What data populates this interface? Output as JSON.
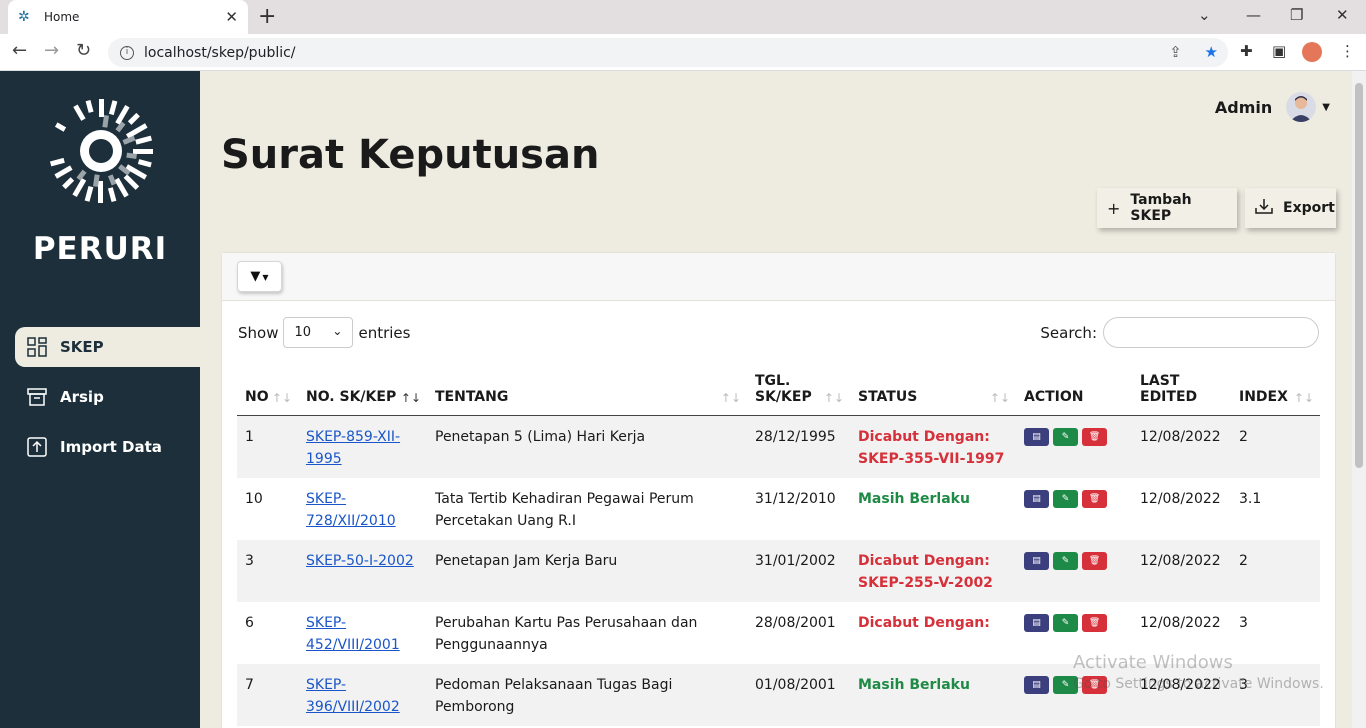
{
  "browser": {
    "tab_title": "Home",
    "url": "localhost/skep/public/"
  },
  "sidebar": {
    "brand": "PERURI",
    "items": [
      {
        "label": "SKEP",
        "icon": "grid-icon"
      },
      {
        "label": "Arsip",
        "icon": "archive-icon"
      },
      {
        "label": "Import Data",
        "icon": "upload-icon"
      }
    ]
  },
  "header": {
    "user": "Admin",
    "title": "Surat Keputusan",
    "add_button": "Tambah SKEP",
    "export_button": "Export"
  },
  "table_controls": {
    "show_label": "Show",
    "entries_value": "10",
    "entries_label": "entries",
    "search_label": "Search:"
  },
  "table": {
    "columns": [
      "NO",
      "NO. SK/KEP",
      "TENTANG",
      "TGL. SK/KEP",
      "STATUS",
      "ACTION",
      "LAST EDITED",
      "INDEX"
    ],
    "rows": [
      {
        "no": "1",
        "sk": "SKEP-859-XII-1995",
        "tentang": "Penetapan 5 (Lima) Hari Kerja",
        "tgl": "28/12/1995",
        "status": "Dicabut Dengan: SKEP-355-VII-1997",
        "status_type": "revoked",
        "edited": "12/08/2022",
        "index": "2"
      },
      {
        "no": "10",
        "sk": "SKEP-728/XII/2010",
        "tentang": "Tata Tertib Kehadiran Pegawai Perum Percetakan Uang R.I",
        "tgl": "31/12/2010",
        "status": "Masih Berlaku",
        "status_type": "active",
        "edited": "12/08/2022",
        "index": "3.1"
      },
      {
        "no": "3",
        "sk": "SKEP-50-I-2002",
        "tentang": "Penetapan Jam Kerja Baru",
        "tgl": "31/01/2002",
        "status": "Dicabut Dengan: SKEP-255-V-2002",
        "status_type": "revoked",
        "edited": "12/08/2022",
        "index": "2"
      },
      {
        "no": "6",
        "sk": "SKEP-452/VIII/2001",
        "tentang": "Perubahan Kartu Pas Perusahaan dan Penggunaannya",
        "tgl": "28/08/2001",
        "status": "Dicabut Dengan:",
        "status_type": "revoked",
        "edited": "12/08/2022",
        "index": "3"
      },
      {
        "no": "7",
        "sk": "SKEP-396/VIII/2002",
        "tentang": "Pedoman Pelaksanaan Tugas Bagi Pemborong",
        "tgl": "01/08/2001",
        "status": "Masih Berlaku",
        "status_type": "active",
        "edited": "12/08/2022",
        "index": "3"
      }
    ]
  },
  "watermark": {
    "line1": "Activate Windows",
    "line2": "Go to Settings to activate Windows."
  },
  "colors": {
    "sidebar": "#1c2f3a",
    "background": "#eeece0",
    "revoked": "#d6303a",
    "active": "#1f8a46",
    "link": "#1a56c9"
  }
}
